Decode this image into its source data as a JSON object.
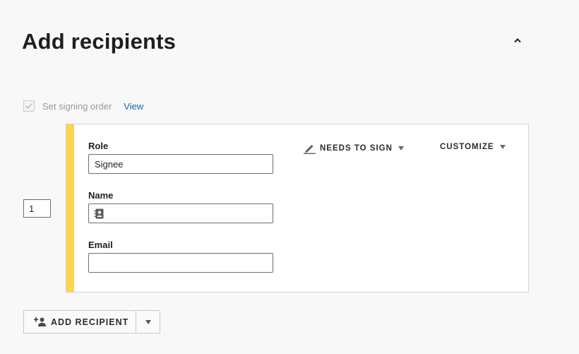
{
  "header": {
    "title": "Add recipients"
  },
  "signing_order": {
    "label": "Set signing order",
    "checked": true,
    "view_link": "View"
  },
  "recipient": {
    "order": "1",
    "role_label": "Role",
    "role_value": "Signee",
    "name_label": "Name",
    "name_value": "",
    "email_label": "Email",
    "email_value": "",
    "action_label": "NEEDS TO SIGN",
    "customize_label": "CUSTOMIZE",
    "stripe_color": "#fdd44c"
  },
  "footer": {
    "add_label": "ADD RECIPIENT"
  },
  "icons": {
    "collapse": "chevron-up-icon",
    "check": "check-icon",
    "contact": "contact-book-icon",
    "pen": "pen-icon",
    "add_person": "add-person-icon"
  }
}
